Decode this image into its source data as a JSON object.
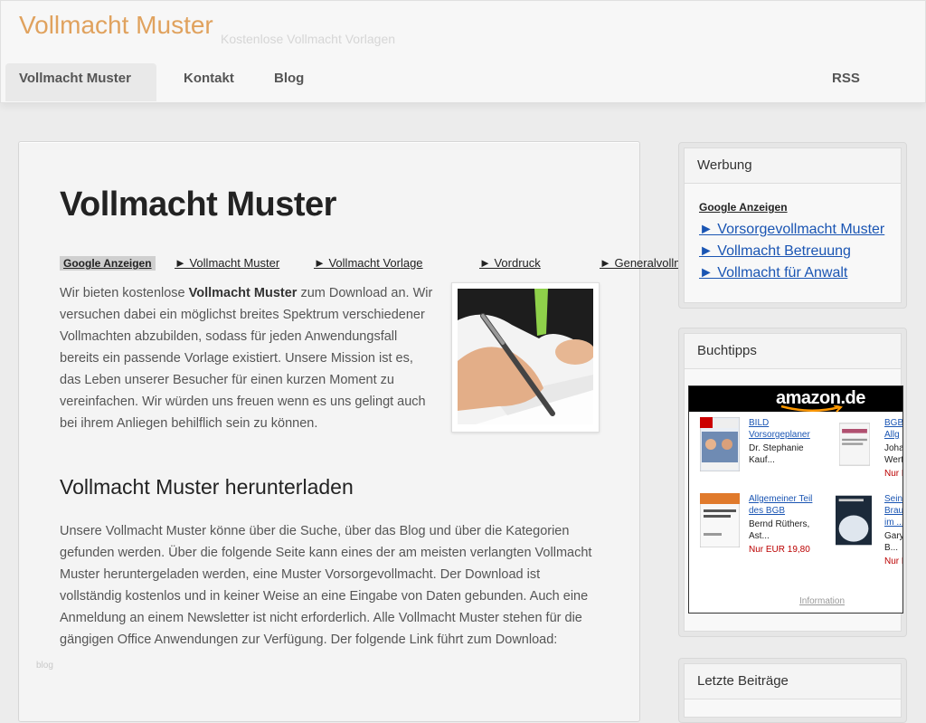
{
  "header": {
    "site_title": "Vollmacht Muster",
    "tagline": "Kostenlose Vollmacht Vorlagen",
    "nav": [
      {
        "label": "Vollmacht Muster"
      },
      {
        "label": "Kontakt"
      },
      {
        "label": "Blog"
      },
      {
        "label": "RSS"
      }
    ]
  },
  "main": {
    "title": "Vollmacht Muster",
    "ads_label": "Google Anzeigen",
    "ad_links": [
      "► Vollmacht Muster",
      "► Vollmacht Vorlage",
      "► Vordruck",
      "► Generalvollmacht"
    ],
    "intro_pre": "Wir bieten kostenlose ",
    "intro_bold": "Vollmacht Muster",
    "intro_post": " zum Download an. Wir versuchen dabei ein möglichst breites Spektrum verschiedener Vollmachten abzubilden, sodass für jeden Anwendungsfall bereits ein passende Vorlage existiert. Unsere Mission ist es, das Leben unserer Besucher für einen kurzen Moment zu vereinfachen. Wir würden uns freuen wenn es uns gelingt auch bei ihrem Anliegen behilflich sein zu können.",
    "section_title": "Vollmacht Muster herunterladen",
    "section_body": "Unsere Vollmacht Muster könne über die Suche, über das Blog und über die Kategorien gefunden werden. Über die folgende Seite kann eines der am meisten verlangten Vollmacht Muster heruntergeladen werden, eine Muster Vorsorgevollmacht. Der Download ist vollständig kostenlos und in keiner Weise an eine Eingabe von Daten gebunden. Auch eine Anmeldung an einem Newsletter ist nicht erforderlich. Alle Vollmacht Muster stehen für die gängigen Office Anwendungen zur Verfügung. Der folgende Link führt zum Download:",
    "watermark": "blog"
  },
  "sidebar": {
    "werbung": {
      "title": "Werbung",
      "ads_label": "Google Anzeigen",
      "links": [
        "► Vorsorgevollmacht Muster",
        "► Vollmacht Betreuung",
        "► Vollmacht für Anwalt"
      ]
    },
    "buchtipps": {
      "title": "Buchtipps",
      "logo": "amazon.de",
      "products": [
        {
          "title1": "BILD",
          "title2": "Vorsorgeplaner",
          "author1": "Dr. Stephanie",
          "author2": "Kauf...",
          "price": ""
        },
        {
          "title1": "BGB",
          "title2": "Allg",
          "author1": "Joha",
          "author2": "Wert",
          "price": "Nur E"
        },
        {
          "title1": "Allgemeiner Teil",
          "title2": "des BGB",
          "author1": "Bernd Rüthers,",
          "author2": "Ast...",
          "price": "Nur EUR 19,80"
        },
        {
          "title1": "Sein",
          "title2": "Brau",
          "title3": "im ...",
          "author1": "Gary",
          "author2": "B...",
          "price": "Nur E"
        }
      ],
      "info": "Information"
    },
    "letzte": {
      "title": "Letzte Beiträge"
    }
  },
  "colors": {
    "title_accent": "#e0a25e",
    "link_blue": "#1a55b3",
    "price_red": "#b00000"
  }
}
